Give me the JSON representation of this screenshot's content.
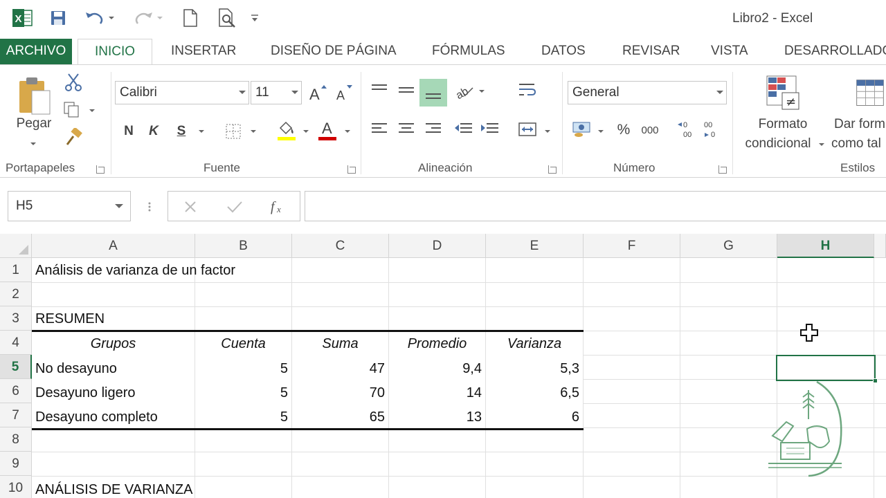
{
  "window": {
    "title": "Libro2 - Excel"
  },
  "colors": {
    "accent": "#217346",
    "highlight_yellow": "#ffff00",
    "font_red": "#d00000",
    "align_active": "#a6d8b7"
  },
  "tabs": [
    {
      "id": "archivo",
      "label": "ARCHIVO"
    },
    {
      "id": "inicio",
      "label": "INICIO"
    },
    {
      "id": "insertar",
      "label": "INSERTAR"
    },
    {
      "id": "diseno",
      "label": "DISEÑO DE PÁGINA"
    },
    {
      "id": "formulas",
      "label": "FÓRMULAS"
    },
    {
      "id": "datos",
      "label": "DATOS"
    },
    {
      "id": "revisar",
      "label": "REVISAR"
    },
    {
      "id": "vista",
      "label": "VISTA"
    },
    {
      "id": "desarrollador",
      "label": "DESARROLLADO"
    }
  ],
  "ribbon": {
    "clipboard": {
      "label": "Portapapeles",
      "paste_label": "Pegar"
    },
    "font": {
      "label": "Fuente",
      "name": "Calibri",
      "size": "11",
      "bold": "N",
      "italic": "K",
      "underline": "S"
    },
    "alignment": {
      "label": "Alineación"
    },
    "number": {
      "label": "Número",
      "format": "General",
      "percent": "%",
      "thousands": "000"
    },
    "styles": {
      "label": "Estilos",
      "cond_format_line1": "Formato",
      "cond_format_line2": "condicional",
      "table_format_line1": "Dar form",
      "table_format_line2": "como tal"
    }
  },
  "formula_bar": {
    "name_box": "H5",
    "content": ""
  },
  "grid": {
    "columns": [
      "A",
      "B",
      "C",
      "D",
      "E",
      "F",
      "G",
      "H"
    ],
    "selected_column": "H",
    "selected_row": "5",
    "rows": [
      "1",
      "2",
      "3",
      "4",
      "5",
      "6",
      "7",
      "8",
      "9",
      "10"
    ],
    "cells": {
      "A1": "Análisis de varianza de un factor",
      "A3": "RESUMEN",
      "A4": "Grupos",
      "B4": "Cuenta",
      "C4": "Suma",
      "D4": "Promedio",
      "E4": "Varianza",
      "A5": "No desayuno",
      "B5": "5",
      "C5": "47",
      "D5": "9,4",
      "E5": "5,3",
      "A6": "Desayuno ligero",
      "B6": "5",
      "C6": "70",
      "D6": "14",
      "E6": "6,5",
      "A7": "Desayuno completo",
      "B7": "5",
      "C7": "65",
      "D7": "13",
      "E7": "6",
      "A10": "ANÁLISIS DE VARIANZA"
    }
  }
}
